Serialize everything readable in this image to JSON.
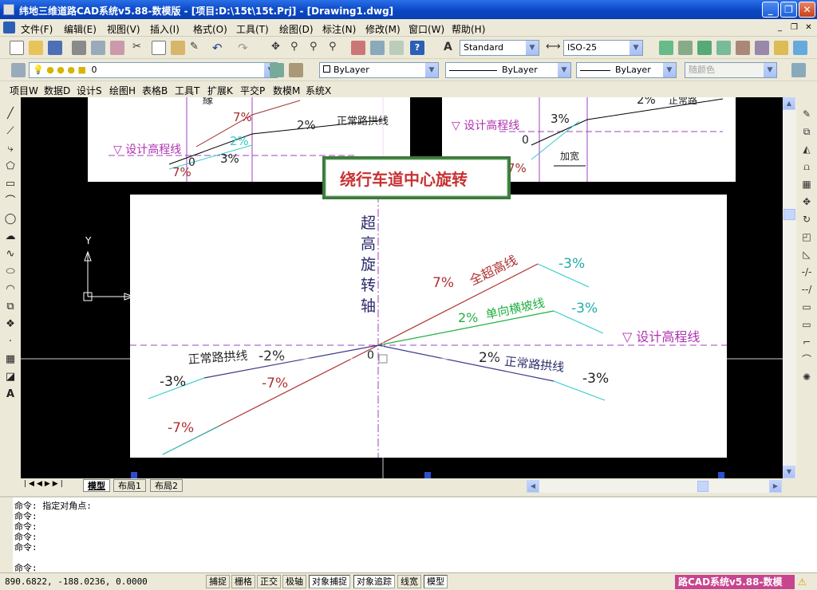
{
  "window": {
    "title": "纬地三维道路CAD系统v5.88-数模版 - [项目:D:\\15t\\15t.Prj] - [Drawing1.dwg]"
  },
  "menu": [
    "文件(F)",
    "编辑(E)",
    "视图(V)",
    "插入(I)",
    "格式(O)",
    "工具(T)",
    "绘图(D)",
    "标注(N)",
    "修改(M)",
    "窗口(W)",
    "帮助(H)"
  ],
  "toolbar": {
    "text_style": "Standard",
    "dim_style": "ISO-25",
    "layer": "0",
    "color": "ByLayer",
    "linetype": "ByLayer",
    "lineweight": "ByLayer",
    "plot_style": "随颜色"
  },
  "menu2": [
    "项目W",
    "数据D",
    "设计S",
    "绘图H",
    "表格B",
    "工具T",
    "扩展K",
    "平交P",
    "数模M",
    "系统X"
  ],
  "drawing": {
    "callout": "绕行车道中心旋转",
    "top_left": {
      "label_design": "设计高程线",
      "label_normal": "正常路拱线",
      "p1": "7%",
      "p2": "2%",
      "p3": "2%",
      "p4": "3%",
      "p5": "7%",
      "zero": "0"
    },
    "top_right": {
      "label_design": "设计高程线",
      "p1": "2%",
      "p2": "3%",
      "p3": "7%",
      "zero": "0",
      "widen": "加宽",
      "cut": "正常路"
    },
    "axis_chars": [
      "超",
      "高",
      "旋",
      "转",
      "轴"
    ],
    "full_super": "全超高线",
    "full_pct": "7%",
    "full_neg": "-3%",
    "one_way": "单向横坡线",
    "one_way_pct": "2%",
    "one_way_neg": "-3%",
    "design_line": "设计高程线",
    "normal_left": "正常路拱线",
    "nl_m2": "-2%",
    "nl_m3": "-3%",
    "nl_m7a": "-7%",
    "nl_m7b": "-7%",
    "normal_right": "正常路拱线",
    "nr_2": "2%",
    "nr_m3": "-3%",
    "zero": "0",
    "ucs_y": "Y"
  },
  "tabs": [
    "模型",
    "布局1",
    "布局2"
  ],
  "command": {
    "history": [
      "命令: 指定对角点:",
      "命令:",
      "命令:",
      "命令:",
      "命令:"
    ],
    "prompt": "命令:"
  },
  "status": {
    "coords": "890.6822,  -188.0236, 0.0000",
    "buttons": [
      "捕捉",
      "栅格",
      "正交",
      "极轴",
      "对象捕捉",
      "对象追踪",
      "线宽",
      "模型"
    ],
    "brand": "路CAD系统v5.88-数模"
  }
}
